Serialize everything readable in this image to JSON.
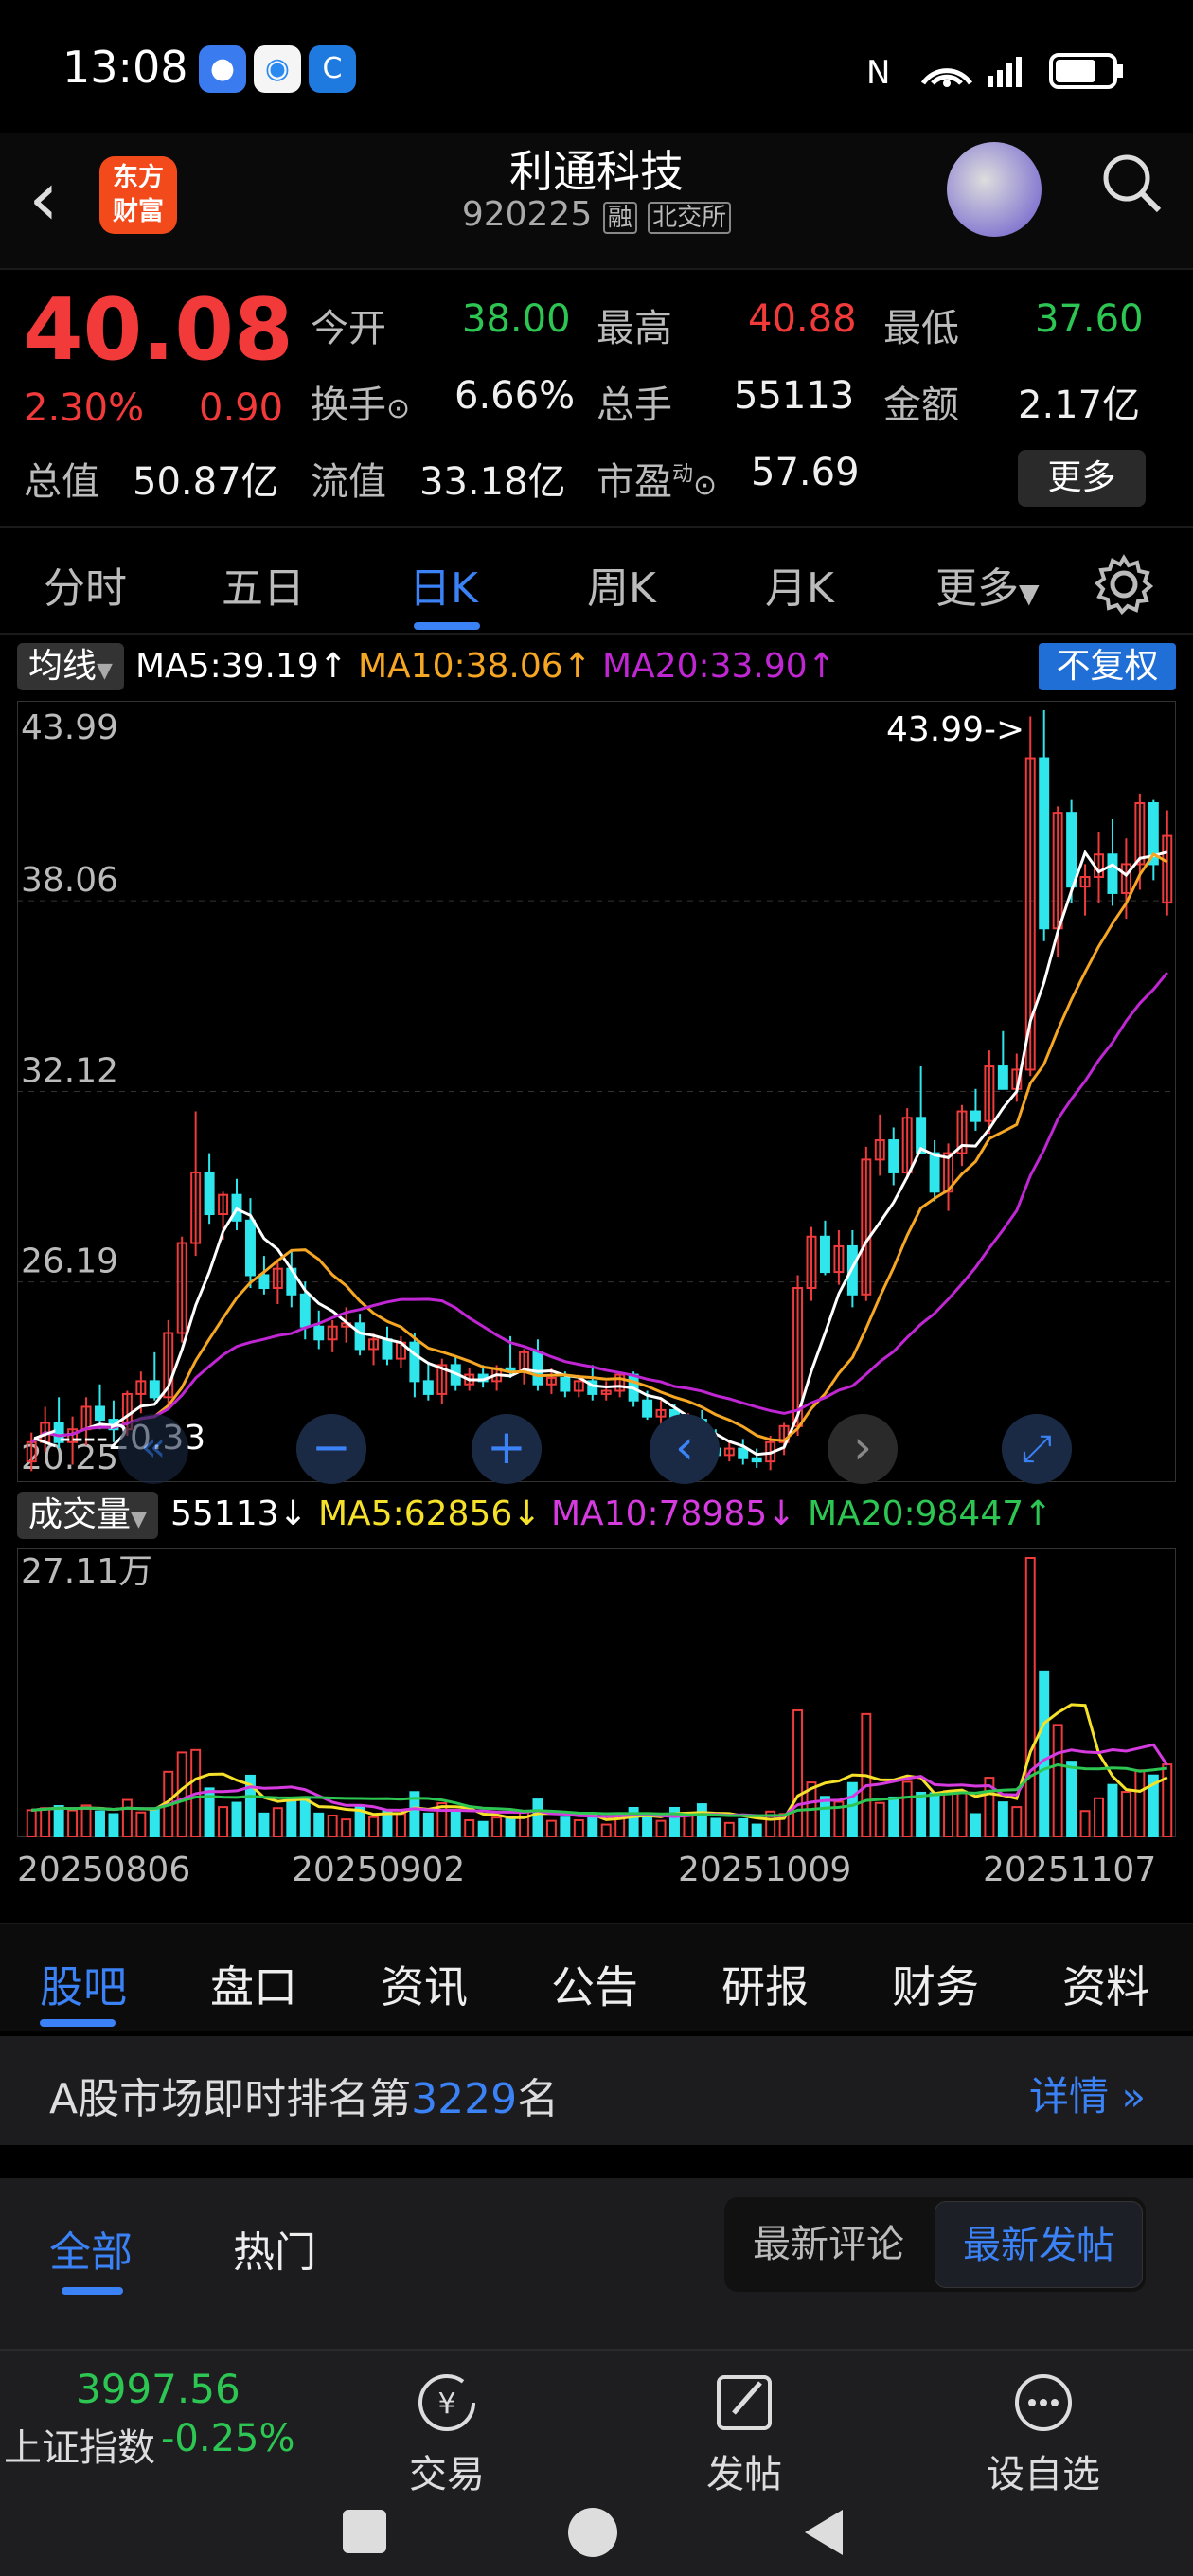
{
  "status_bar": {
    "time": "13:08",
    "icons": [
      "message-icon",
      "mobile-icon",
      "browser-icon"
    ],
    "right_icons": [
      "nfc-icon",
      "wifi-icon",
      "signal-icon",
      "battery-icon"
    ]
  },
  "header": {
    "logo_line1": "东方",
    "logo_line2": "财富",
    "title": "利通科技",
    "code": "920225",
    "tag_margin": "融",
    "tag_exchange": "北交所"
  },
  "quote": {
    "price": "40.08",
    "pct": "2.30%",
    "change": "0.90",
    "rows": [
      [
        {
          "label": "今开",
          "value": "38.00",
          "color": "green"
        },
        {
          "label": "最高",
          "value": "40.88",
          "color": "red"
        },
        {
          "label": "最低",
          "value": "37.60",
          "color": "green"
        }
      ],
      [
        {
          "label": "换手",
          "value": "6.66%",
          "color": "white"
        },
        {
          "label": "总手",
          "value": "55113",
          "color": "white"
        },
        {
          "label": "金额",
          "value": "2.17亿",
          "color": "white"
        }
      ]
    ],
    "total_value_label": "总值",
    "total_value": "50.87亿",
    "float_value_label": "流值",
    "float_value": "33.18亿",
    "pe_label": "市盈",
    "pe_sup": "动",
    "pe_value": "57.69",
    "more_label": "更多"
  },
  "ktabs": [
    "分时",
    "五日",
    "日K",
    "周K",
    "月K",
    "更多"
  ],
  "ktab_active": 2,
  "ma": {
    "selector": "均线",
    "ma5": "MA5:39.19↑",
    "ma10": "MA10:38.06↑",
    "ma20": "MA20:33.90↑",
    "adjust": "不复权",
    "colors": {
      "ma5": "#ffffff",
      "ma10": "#f5a623",
      "ma20": "#c026d3"
    }
  },
  "chart_data": {
    "type": "candlestick",
    "y_ticks": [
      "43.99",
      "38.06",
      "32.12",
      "26.19",
      "20.25"
    ],
    "ylim": [
      20.25,
      43.99
    ],
    "high_annotation": "43.99->",
    "low_annotation": "<----20.33",
    "candles": [
      [
        20.6,
        21.5,
        20.3,
        21.2
      ],
      [
        21.2,
        22.3,
        20.9,
        21.8
      ],
      [
        21.8,
        22.6,
        21.0,
        21.2
      ],
      [
        21.2,
        22.0,
        20.5,
        21.6
      ],
      [
        21.6,
        22.6,
        21.1,
        22.3
      ],
      [
        22.3,
        23.0,
        21.6,
        21.9
      ],
      [
        21.9,
        22.5,
        21.2,
        21.6
      ],
      [
        21.6,
        22.8,
        21.4,
        22.7
      ],
      [
        22.7,
        23.4,
        22.1,
        23.1
      ],
      [
        23.1,
        24.0,
        22.5,
        22.6
      ],
      [
        22.6,
        25.0,
        22.3,
        24.6
      ],
      [
        24.6,
        27.6,
        24.3,
        27.4
      ],
      [
        27.4,
        31.5,
        27.0,
        29.6
      ],
      [
        29.6,
        30.2,
        28.0,
        28.3
      ],
      [
        28.3,
        29.0,
        27.5,
        28.9
      ],
      [
        28.9,
        29.4,
        27.8,
        28.1
      ],
      [
        28.1,
        28.8,
        26.0,
        26.4
      ],
      [
        26.4,
        27.0,
        25.8,
        26.0
      ],
      [
        26.0,
        26.9,
        25.5,
        26.6
      ],
      [
        26.6,
        27.2,
        25.4,
        25.8
      ],
      [
        25.8,
        26.2,
        24.4,
        24.8
      ],
      [
        24.8,
        25.3,
        24.1,
        24.4
      ],
      [
        24.4,
        25.0,
        24.0,
        24.8
      ],
      [
        24.8,
        25.4,
        24.3,
        24.9
      ],
      [
        24.9,
        25.2,
        23.9,
        24.1
      ],
      [
        24.1,
        24.6,
        23.6,
        24.4
      ],
      [
        24.4,
        24.8,
        23.6,
        23.8
      ],
      [
        23.8,
        24.5,
        23.5,
        24.3
      ],
      [
        24.3,
        24.6,
        22.6,
        23.1
      ],
      [
        23.1,
        23.7,
        22.5,
        22.7
      ],
      [
        22.7,
        23.8,
        22.4,
        23.6
      ],
      [
        23.6,
        23.9,
        22.8,
        23.0
      ],
      [
        23.0,
        23.5,
        22.8,
        23.3
      ],
      [
        23.3,
        23.6,
        22.9,
        23.1
      ],
      [
        23.1,
        23.6,
        22.8,
        23.5
      ],
      [
        23.5,
        24.5,
        23.2,
        23.4
      ],
      [
        23.4,
        24.1,
        23.0,
        24.0
      ],
      [
        24.0,
        24.4,
        22.8,
        23.0
      ],
      [
        23.0,
        23.5,
        22.7,
        23.2
      ],
      [
        23.2,
        23.4,
        22.6,
        22.8
      ],
      [
        22.8,
        23.3,
        22.6,
        23.1
      ],
      [
        23.1,
        23.6,
        22.5,
        22.7
      ],
      [
        22.7,
        23.1,
        22.5,
        22.8
      ],
      [
        22.8,
        23.4,
        22.6,
        23.3
      ],
      [
        23.3,
        23.4,
        22.3,
        22.5
      ],
      [
        22.5,
        22.8,
        21.9,
        22.0
      ],
      [
        22.0,
        22.5,
        21.7,
        22.2
      ],
      [
        22.2,
        22.4,
        21.3,
        21.4
      ],
      [
        21.4,
        22.1,
        21.1,
        21.9
      ],
      [
        21.9,
        22.2,
        20.9,
        21.0
      ],
      [
        21.0,
        21.6,
        20.6,
        20.8
      ],
      [
        20.8,
        21.2,
        20.6,
        21.0
      ],
      [
        21.0,
        21.3,
        20.5,
        20.7
      ],
      [
        20.7,
        21.0,
        20.4,
        20.6
      ],
      [
        20.6,
        21.4,
        20.33,
        21.2
      ],
      [
        21.2,
        21.8,
        20.8,
        21.7
      ],
      [
        21.7,
        26.4,
        21.4,
        26.0
      ],
      [
        26.0,
        27.9,
        25.6,
        27.6
      ],
      [
        27.6,
        28.1,
        26.4,
        26.5
      ],
      [
        26.5,
        27.8,
        26.1,
        27.3
      ],
      [
        27.3,
        27.8,
        25.4,
        25.8
      ],
      [
        25.8,
        30.4,
        25.6,
        30.0
      ],
      [
        30.0,
        31.4,
        29.5,
        30.6
      ],
      [
        30.6,
        31.0,
        29.2,
        29.6
      ],
      [
        29.6,
        31.6,
        29.4,
        31.3
      ],
      [
        31.3,
        32.9,
        30.8,
        30.2
      ],
      [
        30.2,
        30.6,
        28.7,
        29.0
      ],
      [
        29.0,
        30.5,
        28.4,
        30.2
      ],
      [
        30.2,
        31.7,
        29.8,
        31.5
      ],
      [
        31.5,
        32.2,
        30.9,
        31.2
      ],
      [
        31.2,
        33.4,
        30.8,
        32.9
      ],
      [
        32.9,
        34.0,
        32.2,
        32.2
      ],
      [
        32.2,
        33.3,
        31.8,
        32.8
      ],
      [
        32.8,
        43.8,
        32.6,
        42.5
      ],
      [
        42.5,
        43.99,
        36.8,
        37.2
      ],
      [
        37.2,
        41.0,
        36.3,
        40.8
      ],
      [
        40.8,
        41.2,
        38.0,
        38.5
      ],
      [
        38.5,
        39.2,
        37.6,
        38.8
      ],
      [
        38.8,
        40.2,
        38.0,
        39.5
      ],
      [
        39.5,
        40.6,
        37.9,
        38.3
      ],
      [
        38.3,
        40.0,
        37.5,
        39.2
      ],
      [
        39.2,
        41.4,
        38.4,
        41.1
      ],
      [
        41.1,
        41.2,
        38.7,
        39.2
      ],
      [
        38.0,
        40.88,
        37.6,
        40.08
      ]
    ],
    "volume_ticks": [
      "27.11万"
    ],
    "volume_dates": [
      "20250806",
      "20250902",
      "20251009",
      "20251107"
    ]
  },
  "volume": {
    "selector": "成交量",
    "current": "55113↓",
    "ma5": "MA5:62856↓",
    "ma10": "MA10:78985↓",
    "ma20": "MA20:98447↑",
    "colors": {
      "ma5": "#f5e12a",
      "ma10": "#d63be0",
      "ma20": "#2dc653"
    }
  },
  "content_tabs": [
    "股吧",
    "盘口",
    "资讯",
    "公告",
    "研报",
    "财务",
    "资料"
  ],
  "rank": {
    "prefix": "A股市场即时排名第",
    "number": "3229",
    "suffix": "名",
    "details": "详情"
  },
  "feed": {
    "tab_all": "全部",
    "tab_hot": "热门",
    "sort_comment": "最新评论",
    "sort_post": "最新发帖"
  },
  "bottombar": {
    "index_value": "3997.56",
    "index_name": "上证指数",
    "index_change": "-0.25%",
    "trade": "交易",
    "post": "发帖",
    "watchlist": "设自选"
  }
}
